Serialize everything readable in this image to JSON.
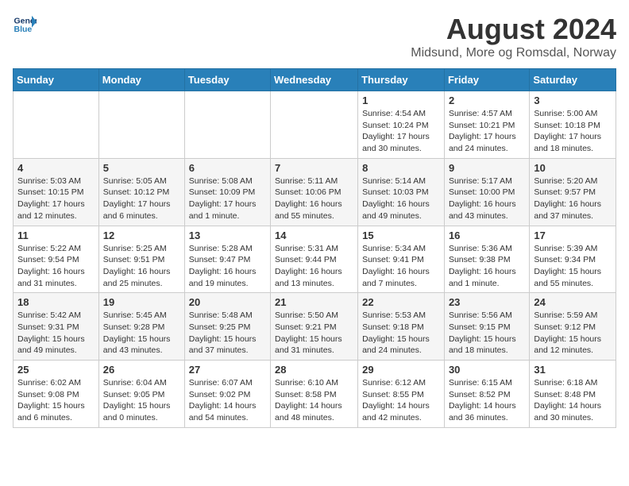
{
  "header": {
    "logo": {
      "line1": "General",
      "line2": "Blue"
    },
    "title": "August 2024",
    "subtitle": "Midsund, More og Romsdal, Norway"
  },
  "calendar": {
    "weekdays": [
      "Sunday",
      "Monday",
      "Tuesday",
      "Wednesday",
      "Thursday",
      "Friday",
      "Saturday"
    ],
    "weeks": [
      [
        {
          "day": "",
          "info": ""
        },
        {
          "day": "",
          "info": ""
        },
        {
          "day": "",
          "info": ""
        },
        {
          "day": "",
          "info": ""
        },
        {
          "day": "1",
          "info": "Sunrise: 4:54 AM\nSunset: 10:24 PM\nDaylight: 17 hours\nand 30 minutes."
        },
        {
          "day": "2",
          "info": "Sunrise: 4:57 AM\nSunset: 10:21 PM\nDaylight: 17 hours\nand 24 minutes."
        },
        {
          "day": "3",
          "info": "Sunrise: 5:00 AM\nSunset: 10:18 PM\nDaylight: 17 hours\nand 18 minutes."
        }
      ],
      [
        {
          "day": "4",
          "info": "Sunrise: 5:03 AM\nSunset: 10:15 PM\nDaylight: 17 hours\nand 12 minutes."
        },
        {
          "day": "5",
          "info": "Sunrise: 5:05 AM\nSunset: 10:12 PM\nDaylight: 17 hours\nand 6 minutes."
        },
        {
          "day": "6",
          "info": "Sunrise: 5:08 AM\nSunset: 10:09 PM\nDaylight: 17 hours\nand 1 minute."
        },
        {
          "day": "7",
          "info": "Sunrise: 5:11 AM\nSunset: 10:06 PM\nDaylight: 16 hours\nand 55 minutes."
        },
        {
          "day": "8",
          "info": "Sunrise: 5:14 AM\nSunset: 10:03 PM\nDaylight: 16 hours\nand 49 minutes."
        },
        {
          "day": "9",
          "info": "Sunrise: 5:17 AM\nSunset: 10:00 PM\nDaylight: 16 hours\nand 43 minutes."
        },
        {
          "day": "10",
          "info": "Sunrise: 5:20 AM\nSunset: 9:57 PM\nDaylight: 16 hours\nand 37 minutes."
        }
      ],
      [
        {
          "day": "11",
          "info": "Sunrise: 5:22 AM\nSunset: 9:54 PM\nDaylight: 16 hours\nand 31 minutes."
        },
        {
          "day": "12",
          "info": "Sunrise: 5:25 AM\nSunset: 9:51 PM\nDaylight: 16 hours\nand 25 minutes."
        },
        {
          "day": "13",
          "info": "Sunrise: 5:28 AM\nSunset: 9:47 PM\nDaylight: 16 hours\nand 19 minutes."
        },
        {
          "day": "14",
          "info": "Sunrise: 5:31 AM\nSunset: 9:44 PM\nDaylight: 16 hours\nand 13 minutes."
        },
        {
          "day": "15",
          "info": "Sunrise: 5:34 AM\nSunset: 9:41 PM\nDaylight: 16 hours\nand 7 minutes."
        },
        {
          "day": "16",
          "info": "Sunrise: 5:36 AM\nSunset: 9:38 PM\nDaylight: 16 hours\nand 1 minute."
        },
        {
          "day": "17",
          "info": "Sunrise: 5:39 AM\nSunset: 9:34 PM\nDaylight: 15 hours\nand 55 minutes."
        }
      ],
      [
        {
          "day": "18",
          "info": "Sunrise: 5:42 AM\nSunset: 9:31 PM\nDaylight: 15 hours\nand 49 minutes."
        },
        {
          "day": "19",
          "info": "Sunrise: 5:45 AM\nSunset: 9:28 PM\nDaylight: 15 hours\nand 43 minutes."
        },
        {
          "day": "20",
          "info": "Sunrise: 5:48 AM\nSunset: 9:25 PM\nDaylight: 15 hours\nand 37 minutes."
        },
        {
          "day": "21",
          "info": "Sunrise: 5:50 AM\nSunset: 9:21 PM\nDaylight: 15 hours\nand 31 minutes."
        },
        {
          "day": "22",
          "info": "Sunrise: 5:53 AM\nSunset: 9:18 PM\nDaylight: 15 hours\nand 24 minutes."
        },
        {
          "day": "23",
          "info": "Sunrise: 5:56 AM\nSunset: 9:15 PM\nDaylight: 15 hours\nand 18 minutes."
        },
        {
          "day": "24",
          "info": "Sunrise: 5:59 AM\nSunset: 9:12 PM\nDaylight: 15 hours\nand 12 minutes."
        }
      ],
      [
        {
          "day": "25",
          "info": "Sunrise: 6:02 AM\nSunset: 9:08 PM\nDaylight: 15 hours\nand 6 minutes."
        },
        {
          "day": "26",
          "info": "Sunrise: 6:04 AM\nSunset: 9:05 PM\nDaylight: 15 hours\nand 0 minutes."
        },
        {
          "day": "27",
          "info": "Sunrise: 6:07 AM\nSunset: 9:02 PM\nDaylight: 14 hours\nand 54 minutes."
        },
        {
          "day": "28",
          "info": "Sunrise: 6:10 AM\nSunset: 8:58 PM\nDaylight: 14 hours\nand 48 minutes."
        },
        {
          "day": "29",
          "info": "Sunrise: 6:12 AM\nSunset: 8:55 PM\nDaylight: 14 hours\nand 42 minutes."
        },
        {
          "day": "30",
          "info": "Sunrise: 6:15 AM\nSunset: 8:52 PM\nDaylight: 14 hours\nand 36 minutes."
        },
        {
          "day": "31",
          "info": "Sunrise: 6:18 AM\nSunset: 8:48 PM\nDaylight: 14 hours\nand 30 minutes."
        }
      ]
    ]
  }
}
